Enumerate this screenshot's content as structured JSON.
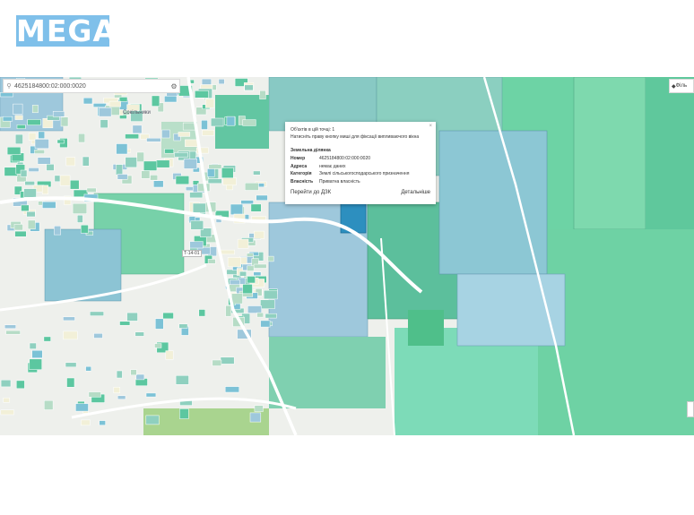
{
  "logo": {
    "text": "MEGA"
  },
  "search": {
    "value": "4625184800:02:000:0020",
    "pin_icon": "pin-icon",
    "settings_icon": "gear-icon"
  },
  "filter": {
    "label": "Філь"
  },
  "map": {
    "road_label": "Т-14-01",
    "village_label": "Сокільники",
    "colors": {
      "background": "#eef0ec",
      "parcel_teal": "#8fd0bf",
      "parcel_blue": "#9ec8dc",
      "parcel_green": "#5cc7a0",
      "selected": "#2d8fbf",
      "field_green": "#6dd3a5"
    }
  },
  "popup": {
    "title": "Об'єктів в цій точці: 1",
    "hint": "Натисніть праву кнопку миші для фіксації випливаючого вікна",
    "section": "Земельна ділянка",
    "rows": [
      {
        "key": "Номер",
        "value": "4625184800:02:000:0020"
      },
      {
        "key": "Адреса",
        "value": "немає даних"
      },
      {
        "key": "Категорія",
        "value": "Землі сільськогосподарського призначення"
      },
      {
        "key": "Власність",
        "value": "Приватна власність"
      }
    ],
    "action_left": "Перейти до ДЗК",
    "action_right": "Детальніше",
    "close": "×"
  }
}
